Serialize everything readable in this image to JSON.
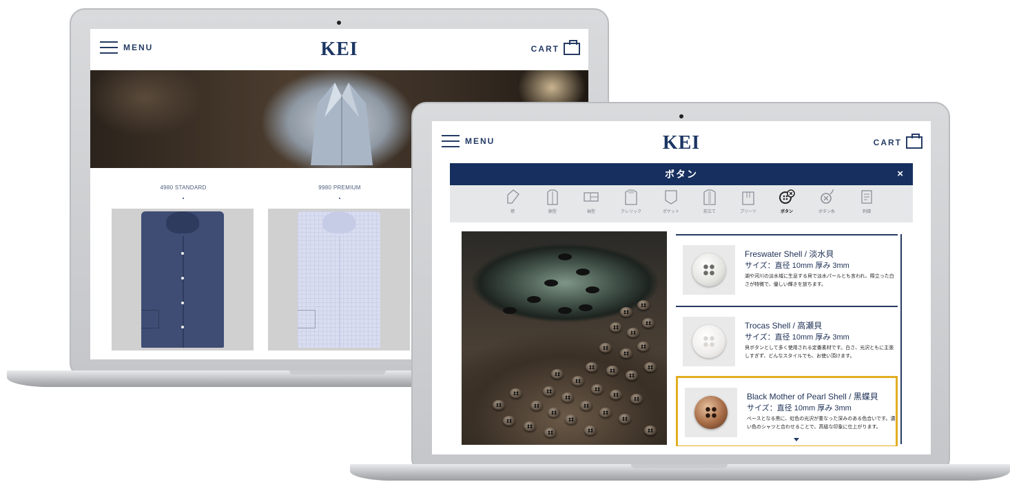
{
  "back_screen": {
    "header": {
      "menu_label": "MENU",
      "logo": "KEI",
      "cart_label": "CART"
    },
    "products": [
      {
        "label": "4980 STANDARD",
        "shirt_color": "#3f4d74"
      },
      {
        "label": "9980 PREMIUM",
        "shirt_color": "#d9ddf0"
      }
    ]
  },
  "front_screen": {
    "header": {
      "menu_label": "MENU",
      "logo": "KEI",
      "cart_label": "CART"
    },
    "panel": {
      "title": "ボタン",
      "close_label": "×",
      "options": [
        {
          "label": "襟",
          "icon": "collar-icon",
          "active": false
        },
        {
          "label": "胴型",
          "icon": "body-shape-icon",
          "active": false
        },
        {
          "label": "袖型",
          "icon": "sleeve-shape-icon",
          "active": false
        },
        {
          "label": "クレリック",
          "icon": "cleric-icon",
          "active": false
        },
        {
          "label": "ポケット",
          "icon": "pocket-icon",
          "active": false
        },
        {
          "label": "前立て",
          "icon": "placket-icon",
          "active": false
        },
        {
          "label": "プリーツ",
          "icon": "pleat-icon",
          "active": false
        },
        {
          "label": "ボタン",
          "icon": "button-icon",
          "active": true
        },
        {
          "label": "ボタン糸",
          "icon": "button-thread-icon",
          "active": false
        },
        {
          "label": "刺繍",
          "icon": "embroidery-icon",
          "active": false
        }
      ]
    },
    "button_options": [
      {
        "name": "Freswater Shell / 淡水貝",
        "size": "サイズ：直径 10mm 厚み 3mm",
        "description": "湖や河川の淡水域に生息する貝で淡水パールとも言われ、際立った白さが特徴で、優しい輝きを放ちます。",
        "color": "#f1f1ee",
        "selected": false
      },
      {
        "name": "Trocas Shell / 高瀬貝",
        "size": "サイズ：直径 10mm 厚み 3mm",
        "description": "貝ボタンとして多く使用される定番素材です。白さ、光沢ともに主張しすぎず、どんなスタイルでも、お使い頂けます。",
        "color": "#f6f4f2",
        "selected": false
      },
      {
        "name": "Black Mother of Pearl Shell / 黒蝶貝",
        "size": "サイズ：直径 10mm 厚み 3mm",
        "description": "ベースとなる黒に、虹色の光沢が重なった深みのある色合いです。濃い色のシャツと合わせることで、高級な印象に仕上がります。",
        "color": "#8a5a3a",
        "selected": true
      }
    ]
  }
}
